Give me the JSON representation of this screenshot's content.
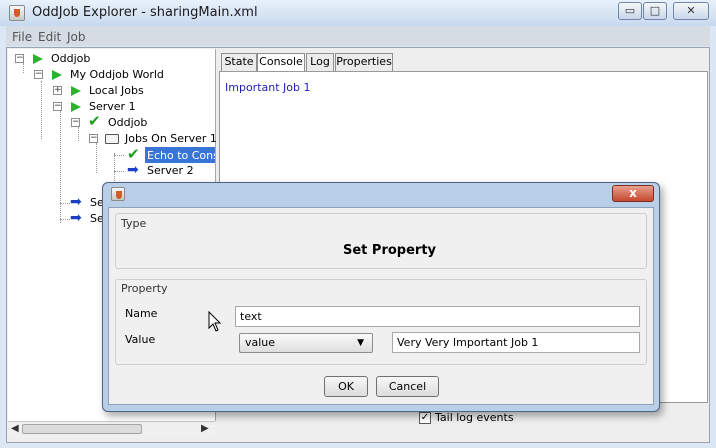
{
  "window": {
    "title": "OddJob Explorer - sharingMain.xml",
    "controls": {
      "minimize": "▭",
      "maximize": "□",
      "close": "✕"
    }
  },
  "menubar": {
    "items": [
      "File",
      "Edit",
      "Job"
    ]
  },
  "tree": {
    "nodes": [
      {
        "label": "Oddjob",
        "icon": "green-flag-icon"
      },
      {
        "label": "My Oddjob World",
        "icon": "green-flag-icon"
      },
      {
        "label": "Local Jobs",
        "icon": "green-flag-icon"
      },
      {
        "label": "Server 1",
        "icon": "green-flag-icon"
      },
      {
        "label": "Oddjob",
        "icon": "green-check-icon"
      },
      {
        "label": "Jobs On Server 1",
        "icon": "folder-icon"
      },
      {
        "label": "Echo to Conso",
        "icon": "green-check-icon",
        "selected": true
      },
      {
        "label": "Server 2",
        "icon": "blue-arrow-icon"
      },
      {
        "label": "Se",
        "icon": "blue-arrow-icon"
      },
      {
        "label": "Se",
        "icon": "blue-arrow-icon"
      }
    ]
  },
  "tabs": [
    {
      "label": "State",
      "selected": false
    },
    {
      "label": "Console",
      "selected": true
    },
    {
      "label": "Log",
      "selected": false
    },
    {
      "label": "Properties",
      "selected": false
    }
  ],
  "console": {
    "lines": [
      "Important Job 1"
    ]
  },
  "tail_log": {
    "label": "Tail log events",
    "checked": true
  },
  "dialog": {
    "close_label": "x",
    "type_section": {
      "legend": "Type",
      "heading": "Set Property"
    },
    "property_section": {
      "legend": "Property",
      "name_label": "Name",
      "name_value": "text",
      "value_label": "Value",
      "value_select": "value",
      "value_text": "Very Very Important Job 1"
    },
    "ok_label": "OK",
    "cancel_label": "Cancel"
  },
  "colors": {
    "title_bar": "#c8d9ee",
    "selection": "#3875d7",
    "console_text": "#1f1fb8",
    "close_button": "#c6472f"
  }
}
